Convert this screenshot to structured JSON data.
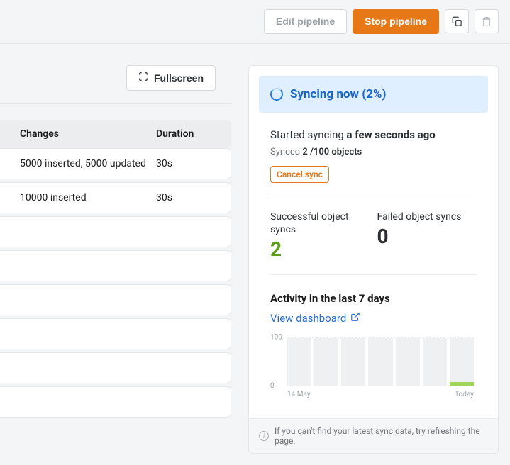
{
  "toolbar": {
    "edit_label": "Edit pipeline",
    "stop_label": "Stop pipeline"
  },
  "left": {
    "fullscreen_label": "Fullscreen",
    "cols": {
      "changes": "Changes",
      "duration": "Duration"
    },
    "rows": [
      {
        "changes": "5000 inserted, 5000 updated",
        "duration": "30s"
      },
      {
        "changes": "10000 inserted",
        "duration": "30s"
      }
    ],
    "empty_rows": 6
  },
  "panel": {
    "sync_title": "Syncing now (2%)",
    "started_prefix": "Started syncing ",
    "started_ago": "a few seconds ago",
    "synced_prefix": "Synced ",
    "synced_value": "2 /100 objects",
    "cancel_label": "Cancel sync",
    "stats": [
      {
        "label": "Successful object syncs",
        "value": "2"
      },
      {
        "label": "Failed object syncs",
        "value": "0"
      }
    ],
    "activity_title": "Activity in the last 7 days",
    "dashboard_label": "View dashboard",
    "footer_text": "If you can't find your latest sync data, try refreshing the page."
  },
  "chart_data": {
    "type": "bar",
    "categories": [
      "14 May",
      "",
      "",
      "",
      "",
      "",
      "Today"
    ],
    "values": [
      0,
      0,
      0,
      0,
      0,
      0,
      8
    ],
    "xlabel": "",
    "ylabel": "",
    "ylim": [
      0,
      100
    ],
    "x_ticks": [
      "14 May",
      "Today"
    ],
    "y_ticks": [
      0,
      100
    ]
  }
}
